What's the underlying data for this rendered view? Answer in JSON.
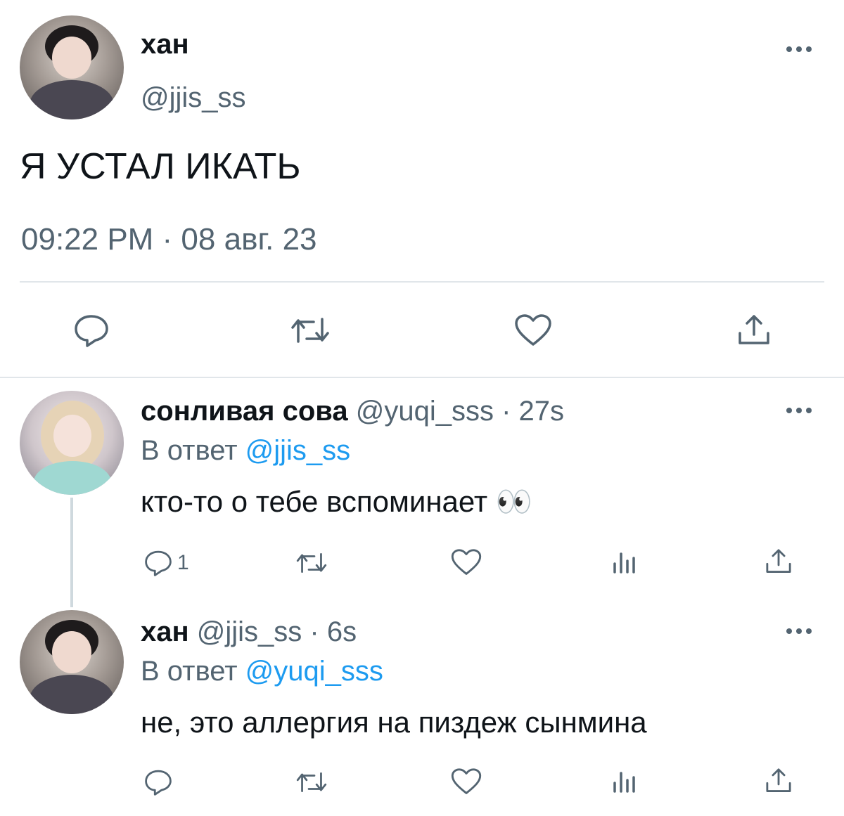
{
  "main_tweet": {
    "name": "хан",
    "handle": "@jjis_ss",
    "text": "Я УСТАЛ ИКАТЬ",
    "timestamp": "09:22 PM · 08 авг. 23",
    "avatar_icon": "user-avatar"
  },
  "replies": [
    {
      "name": "сонливая сова",
      "handle": "@yuqi_sss",
      "time": "· 27s",
      "reply_prefix": "В ответ",
      "reply_to": "@jjis_ss",
      "text": "кто-то о тебе вспоминает",
      "emoji": "👀",
      "reply_count": "1"
    },
    {
      "name": "хан",
      "handle": "@jjis_ss",
      "time": "· 6s",
      "reply_prefix": "В ответ",
      "reply_to": "@yuqi_sss",
      "text": "не, это аллергия на пиздеж сынмина",
      "reply_count": ""
    }
  ],
  "colors": {
    "text": "#0f1419",
    "secondary": "#536471",
    "link": "#1d9bf0",
    "divider": "#e1e6ea"
  }
}
